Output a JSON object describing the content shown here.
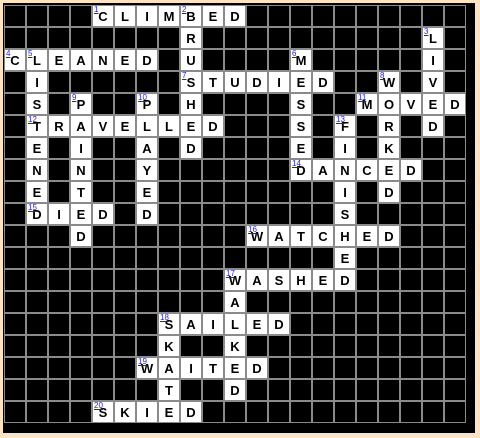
{
  "puzzle": {
    "grid": {
      "cols": 21,
      "rows": 19,
      "border_color": "#8a8a8a",
      "block_color": "#000000",
      "open_color": "#ffffff",
      "number_color": "#1a1aff"
    },
    "entries": [
      {
        "number": "1",
        "answer": "CLIMBED",
        "direction": "across",
        "row": 0,
        "col": 4
      },
      {
        "number": "2",
        "answer": "BRUSHED",
        "direction": "down",
        "row": 0,
        "col": 8
      },
      {
        "number": "3",
        "answer": "LIVED",
        "direction": "down",
        "row": 1,
        "col": 19
      },
      {
        "number": "4",
        "answer": "CLEANED",
        "direction": "across",
        "row": 2,
        "col": 0
      },
      {
        "number": "5",
        "answer": "LISTENED",
        "direction": "down",
        "row": 2,
        "col": 1
      },
      {
        "number": "6",
        "answer": "MISSED",
        "direction": "down",
        "row": 2,
        "col": 13
      },
      {
        "number": "7",
        "answer": "STUDIED",
        "direction": "across",
        "row": 3,
        "col": 8
      },
      {
        "number": "8",
        "answer": "WORKED",
        "direction": "down",
        "row": 3,
        "col": 17
      },
      {
        "number": "9",
        "answer": "PAINTED",
        "direction": "down",
        "row": 4,
        "col": 3
      },
      {
        "number": "10",
        "answer": "PLAYED",
        "direction": "down",
        "row": 4,
        "col": 6
      },
      {
        "number": "11",
        "answer": "MOVED",
        "direction": "across",
        "row": 4,
        "col": 16
      },
      {
        "number": "12",
        "answer": "TRAVELLED",
        "direction": "across",
        "row": 5,
        "col": 1
      },
      {
        "number": "13",
        "answer": "FINISHED",
        "direction": "down",
        "row": 5,
        "col": 15
      },
      {
        "number": "14",
        "answer": "DANCED",
        "direction": "across",
        "row": 7,
        "col": 13
      },
      {
        "number": "15",
        "answer": "DIED",
        "direction": "across",
        "row": 9,
        "col": 1
      },
      {
        "number": "16",
        "answer": "WATCHED",
        "direction": "across",
        "row": 10,
        "col": 11
      },
      {
        "number": "17",
        "answer": "WASHED",
        "direction": "across",
        "row": 12,
        "col": 10
      },
      {
        "number": "18",
        "answer": "SAILED",
        "direction": "across",
        "row": 14,
        "col": 7
      },
      {
        "number": "19",
        "answer": "WAITED",
        "direction": "across",
        "row": 16,
        "col": 6
      },
      {
        "number": "20",
        "answer": "SKIED",
        "direction": "across",
        "row": 18,
        "col": 4
      }
    ],
    "extra_down": [
      {
        "answer": "WALKED",
        "row": 12,
        "col": 10
      },
      {
        "answer": "SKATED",
        "row": 14,
        "col": 7
      }
    ]
  }
}
